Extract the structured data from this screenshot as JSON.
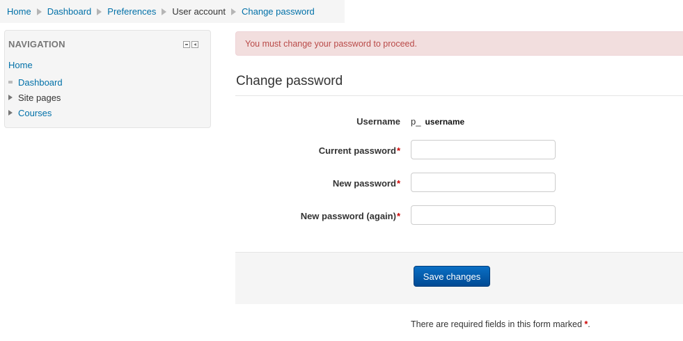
{
  "breadcrumb": {
    "items": [
      {
        "label": "Home",
        "link": true
      },
      {
        "label": "Dashboard",
        "link": true
      },
      {
        "label": "Preferences",
        "link": true
      },
      {
        "label": "User account",
        "link": false
      },
      {
        "label": "Change password",
        "link": true
      }
    ]
  },
  "navigation": {
    "title": "NAVIGATION",
    "home": "Home",
    "items": [
      {
        "label": "Dashboard",
        "icon": "bullet-icon",
        "link": true
      },
      {
        "label": "Site pages",
        "icon": "expand-arrow-icon",
        "link": false
      },
      {
        "label": "Courses",
        "icon": "expand-arrow-icon",
        "link": true
      }
    ]
  },
  "alert": {
    "message": "You must change your password to proceed."
  },
  "page": {
    "heading": "Change password"
  },
  "form": {
    "username_label": "Username",
    "username_prefix": "p_",
    "username_value": "username",
    "current_password_label": "Current password",
    "current_password_value": "",
    "new_password_label": "New password",
    "new_password_value": "",
    "new_password_again_label": "New password (again)",
    "new_password_again_value": "",
    "required_marker": "*",
    "save_label": "Save changes",
    "required_note_text": "There are required fields in this form marked ",
    "required_note_end": "."
  },
  "colors": {
    "link": "#0070a8",
    "alert_bg": "#f2dede",
    "alert_text": "#b94a48",
    "button": "#0a5fb0",
    "required": "#cc0000"
  }
}
